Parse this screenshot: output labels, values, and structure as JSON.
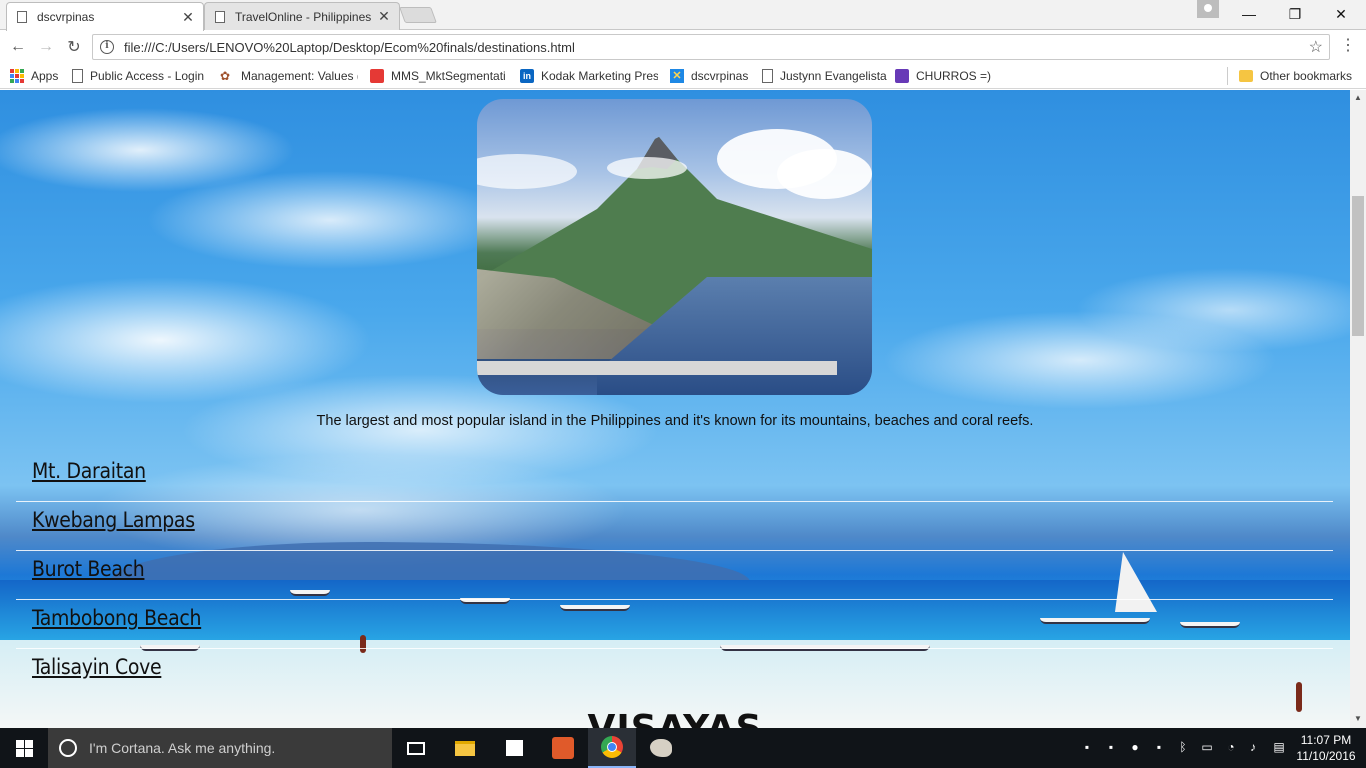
{
  "browser": {
    "tabs": [
      {
        "title": "dscvrpinas",
        "active": true
      },
      {
        "title": "TravelOnline - Philippines",
        "active": false
      }
    ],
    "url": "file:///C:/Users/LENOVO%20Laptop/Desktop/Ecom%20finals/destinations.html",
    "bookmarks": [
      {
        "label": "Apps",
        "icon": "apps-grid-icon"
      },
      {
        "label": "Public Access - Login",
        "icon": "page-icon"
      },
      {
        "label": "Management: Values (",
        "icon": "management-icon"
      },
      {
        "label": "MMS_MktSegmentati",
        "icon": "mms-icon"
      },
      {
        "label": "Kodak Marketing Pres",
        "icon": "linkedin-icon"
      },
      {
        "label": "dscvrpinas",
        "icon": "x-logo-icon"
      },
      {
        "label": "Justynn Evangelista",
        "icon": "page-icon"
      },
      {
        "label": "CHURROS =)",
        "icon": "forms-icon"
      }
    ],
    "other_bookmarks": "Other bookmarks",
    "colors": {
      "linkedin": "#0a66c2",
      "forms": "#673ab7",
      "mms": "#e53935",
      "folder": "#f5c542"
    }
  },
  "page": {
    "description": "The largest and most popular island in the Philippines and it's known for its mountains, beaches and coral reefs.",
    "destinations": [
      "Mt. Daraitan",
      "Kwebang Lampas",
      "Burot Beach",
      "Tambobong Beach",
      "Talisayin Cove"
    ],
    "next_section": "VISAYAS"
  },
  "taskbar": {
    "search_placeholder": "I'm Cortana. Ask me anything.",
    "time": "11:07 PM",
    "date": "11/10/2016"
  }
}
